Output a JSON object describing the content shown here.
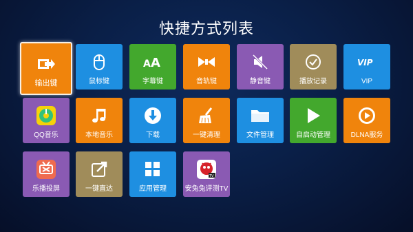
{
  "title": "快捷方式列表",
  "tiles": [
    {
      "label": "输出键",
      "icon": "output-icon",
      "color": "#f0840c"
    },
    {
      "label": "鼠标键",
      "icon": "mouse-icon",
      "color": "#1e8fe1"
    },
    {
      "label": "字幕键",
      "icon": "subtitle-icon",
      "color": "#43a82d"
    },
    {
      "label": "音轨键",
      "icon": "audio-track-icon",
      "color": "#f0840c"
    },
    {
      "label": "静音键",
      "icon": "mute-icon",
      "color": "#8a5ab3"
    },
    {
      "label": "播放记录",
      "icon": "play-history-icon",
      "color": "#a08c5a"
    },
    {
      "label": "VIP",
      "icon": "vip-icon",
      "color": "#1e8fe1"
    },
    {
      "label": "QQ音乐",
      "icon": "qq-music-icon",
      "color": "#8a5ab3"
    },
    {
      "label": "本地音乐",
      "icon": "music-note-icon",
      "color": "#f0840c"
    },
    {
      "label": "下载",
      "icon": "download-icon",
      "color": "#1e8fe1"
    },
    {
      "label": "一键清理",
      "icon": "broom-icon",
      "color": "#f0840c"
    },
    {
      "label": "文件管理",
      "icon": "folder-icon",
      "color": "#1e8fe1"
    },
    {
      "label": "自启动管理",
      "icon": "play-icon",
      "color": "#43a82d"
    },
    {
      "label": "DLNA服务",
      "icon": "dlna-icon",
      "color": "#f0840c"
    },
    {
      "label": "乐播投屏",
      "icon": "lebo-cast-icon",
      "color": "#8a5ab3"
    },
    {
      "label": "一键直达",
      "icon": "shortcut-icon",
      "color": "#a08c5a"
    },
    {
      "label": "应用管理",
      "icon": "app-grid-icon",
      "color": "#1e8fe1"
    },
    {
      "label": "安兔兔评测TV",
      "icon": "antutu-icon",
      "color": "#8a5ab3"
    }
  ],
  "selected_index": 0
}
